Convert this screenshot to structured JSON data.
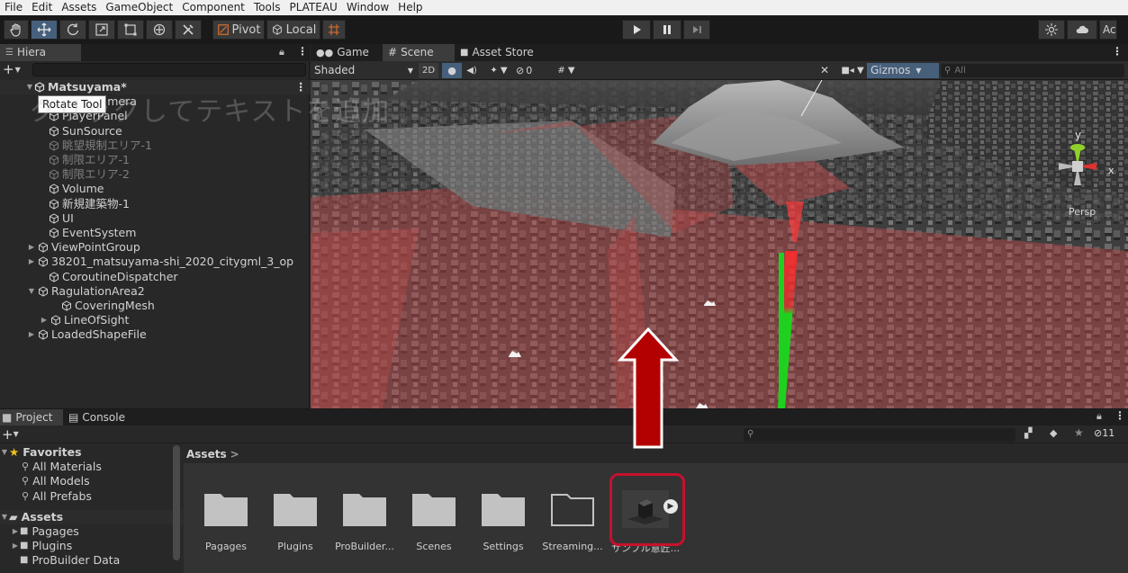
{
  "menu": [
    "File",
    "Edit",
    "Assets",
    "GameObject",
    "Component",
    "Tools",
    "PLATEAU",
    "Window",
    "Help"
  ],
  "toolbar": {
    "pivot_label": "Pivot",
    "local_label": "Local",
    "account_label": "Ac"
  },
  "tooltip": "Rotate Tool",
  "hierarchy": {
    "tab_label": "Hiera",
    "scene_name": "Matsuyama*",
    "items": [
      {
        "label": "Main Camera",
        "dim": false
      },
      {
        "label": "PlayerPanel",
        "dim": false
      },
      {
        "label": "SunSource",
        "dim": false
      },
      {
        "label": "眺望規制エリア-1",
        "dim": true
      },
      {
        "label": "制限エリア-1",
        "dim": true
      },
      {
        "label": "制限エリア-2",
        "dim": true
      },
      {
        "label": "Volume",
        "dim": false
      },
      {
        "label": "新規建築物-1",
        "dim": false
      },
      {
        "label": "UI",
        "dim": false
      },
      {
        "label": "EventSystem",
        "dim": false
      },
      {
        "label": "ViewPointGroup",
        "dim": false
      },
      {
        "label": "38201_matsuyama-shi_2020_citygml_3_op",
        "dim": false
      },
      {
        "label": "CoroutineDispatcher",
        "dim": false
      },
      {
        "label": "RagulationArea2",
        "dim": false
      },
      {
        "label": "CoveringMesh",
        "dim": false
      },
      {
        "label": "LineOfSight",
        "dim": false
      },
      {
        "label": "LoadedShapeFile",
        "dim": false
      }
    ],
    "overlay_text": "クリックしてテキストを追加"
  },
  "scene": {
    "tabs": [
      "Game",
      "Scene",
      "Asset Store"
    ],
    "shading": "Shaded",
    "mode_2d": "2D",
    "hidden_count": "0",
    "gizmos_label": "Gizmos",
    "search_placeholder": "All",
    "axis_y": "y",
    "axis_x": "x",
    "persp_label": "Persp"
  },
  "project": {
    "tabs": [
      "Project",
      "Console"
    ],
    "hidden_count": "11",
    "breadcrumb": "Assets",
    "favorites_label": "Favorites",
    "favorites": [
      "All Materials",
      "All Models",
      "All Prefabs"
    ],
    "assets_label": "Assets",
    "asset_tree": [
      "Pagages",
      "Plugins",
      "ProBuilder Data"
    ],
    "assets": [
      "Pagages",
      "Plugins",
      "ProBuilder...",
      "Scenes",
      "Settings",
      "Streaming...",
      "サンプル意匠..."
    ]
  },
  "colors": {
    "highlight_red": "#c8102e",
    "arrow_red": "#b30000",
    "restricted_area": "#c24a4a",
    "line_of_sight_green": "#1fd11f"
  }
}
